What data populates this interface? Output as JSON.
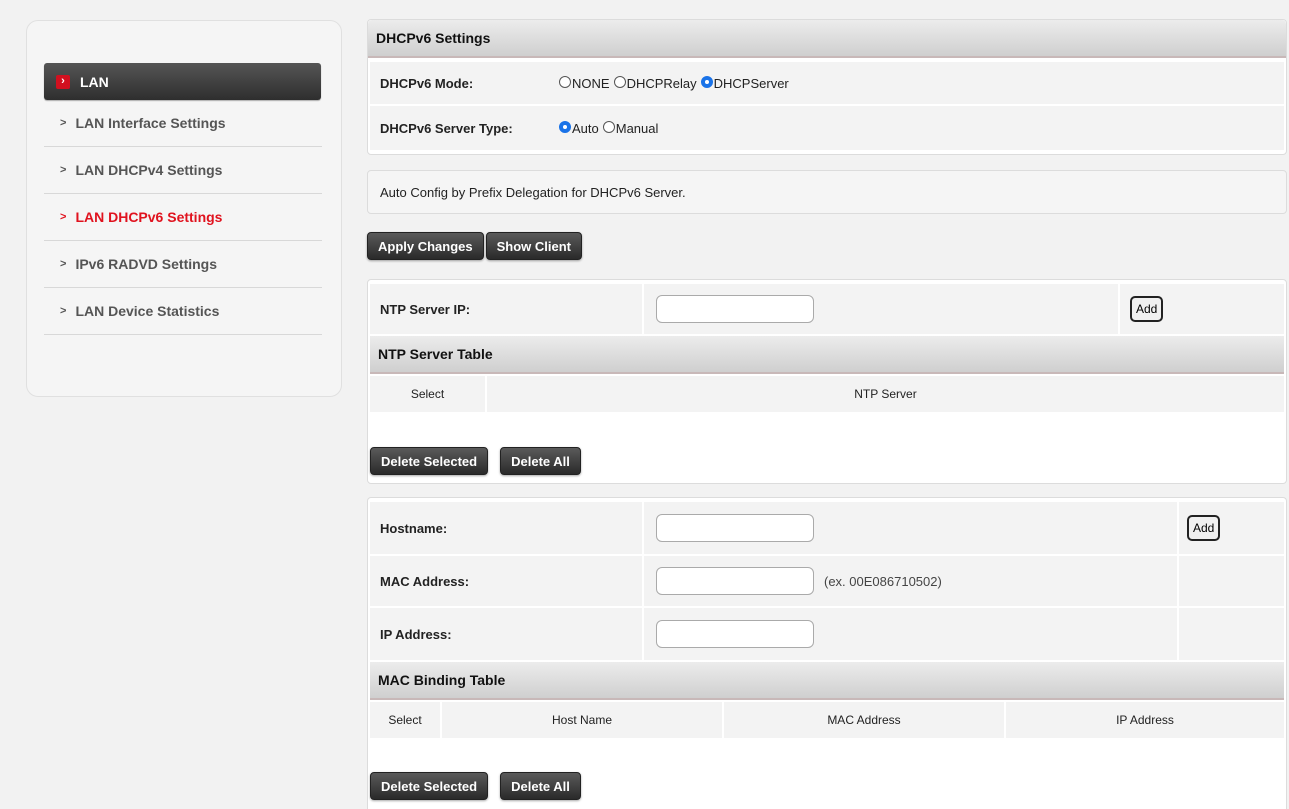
{
  "sidebar": {
    "header": "LAN",
    "items": [
      {
        "label": "LAN Interface Settings",
        "active": false
      },
      {
        "label": "LAN DHCPv4 Settings",
        "active": false
      },
      {
        "label": "LAN DHCPv6 Settings",
        "active": true
      },
      {
        "label": "IPv6 RADVD Settings",
        "active": false
      },
      {
        "label": "LAN Device Statistics",
        "active": false
      }
    ]
  },
  "dhcpv6": {
    "title": "DHCPv6 Settings",
    "mode_label": "DHCPv6 Mode:",
    "mode_options": [
      "NONE",
      "DHCPRelay",
      "DHCPServer"
    ],
    "mode_selected": "DHCPServer",
    "server_type_label": "DHCPv6 Server Type:",
    "server_type_options": [
      "Auto",
      "Manual"
    ],
    "server_type_selected": "Auto"
  },
  "info_text": "Auto Config by Prefix Delegation for DHCPv6 Server.",
  "actions": {
    "apply_label": "Apply Changes",
    "show_client_label": "Show Client"
  },
  "ntp": {
    "server_ip_label": "NTP Server IP:",
    "server_ip_value": "",
    "add_label": "Add",
    "table_title": "NTP Server Table",
    "columns": [
      "Select",
      "NTP Server"
    ],
    "delete_selected_label": "Delete Selected",
    "delete_all_label": "Delete All"
  },
  "binding": {
    "hostname_label": "Hostname:",
    "hostname_value": "",
    "add_label": "Add",
    "mac_label": "MAC Address:",
    "mac_value": "",
    "mac_hint": "(ex. 00E086710502)",
    "ip_label": "IP Address:",
    "ip_value": "",
    "table_title": "MAC Binding Table",
    "columns": [
      "Select",
      "Host Name",
      "MAC Address",
      "IP Address"
    ],
    "delete_selected_label": "Delete Selected",
    "delete_all_label": "Delete All"
  },
  "colors": {
    "accent_red": "#e0121e",
    "radio_blue": "#1a73e8",
    "button_dark": "#2a2a2a"
  }
}
